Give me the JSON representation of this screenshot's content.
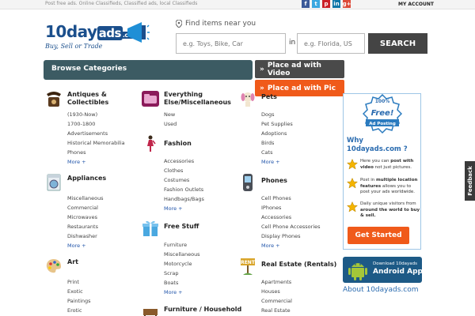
{
  "topbar": {
    "tagline": "Post free ads. Online Classifieds, Classified ads, local Classifieds",
    "socials": [
      {
        "icon": "facebook-icon",
        "glyph": "f",
        "color": "#3b5998"
      },
      {
        "icon": "twitter-icon",
        "glyph": "t",
        "color": "#3aa8e0"
      },
      {
        "icon": "pinterest-icon",
        "glyph": "p",
        "color": "#cb2027"
      },
      {
        "icon": "linkedin-icon",
        "glyph": "in",
        "color": "#0e76a8"
      },
      {
        "icon": "google-plus-icon",
        "glyph": "g+",
        "color": "#dd4b39"
      }
    ],
    "my_account": "MY ACCOUNT"
  },
  "header": {
    "logo_main": "10day",
    "logo_ads": "ads",
    "logo_com": ".com",
    "logo_sub": "Buy, Sell or Trade",
    "find_label": "Find items near you",
    "search_placeholder": "e.g. Toys, Bike, Car",
    "in_label": "in",
    "location_placeholder": "e.g. Florida, US",
    "search_button": "SEARCH"
  },
  "nav": {
    "browse_label": "Browse Categories",
    "place_video": "Place ad with Video",
    "place_pic": "Place ad with Pic"
  },
  "categories": {
    "antiques": {
      "title": "Antiques & Collectibles",
      "items": [
        "(1930-Now)",
        "1700-1800",
        "Advertisements",
        "Historical Memorabilia",
        "Phones",
        "More +"
      ]
    },
    "appliances": {
      "title": "Appliances",
      "items": [
        "Miscellaneous",
        "Commercial",
        "Microwaves",
        "Restaurants",
        "Dishwasher",
        "More +"
      ]
    },
    "art": {
      "title": "Art",
      "items": [
        "Print",
        "Exotic",
        "Paintings",
        "Erotic"
      ]
    },
    "everything": {
      "title": "Everything Else/Miscellaneous",
      "items": [
        "New",
        "Used"
      ]
    },
    "fashion": {
      "title": "Fashion",
      "items": [
        "Accessories",
        "Clothes",
        "Costumes",
        "Fashion Outlets",
        "Handbags/Bags",
        "More +"
      ]
    },
    "freestuff": {
      "title": "Free Stuff",
      "items": [
        "Furniture",
        "Miscellaneous",
        "Motorcycle",
        "Scrap",
        "Boats",
        "More +"
      ]
    },
    "furniture": {
      "title": "Furniture / Household",
      "items": []
    },
    "pets": {
      "title": "Pets",
      "items": [
        "Dogs",
        "Pet Supplies",
        "Adoptions",
        "Birds",
        "Cats",
        "More +"
      ]
    },
    "phones": {
      "title": "Phones",
      "items": [
        "Cell Phones",
        "IPhones",
        "Accessories",
        "Cell Phone Accessories",
        "Display Phones",
        "More +"
      ]
    },
    "realestate": {
      "title": "Real Estate (Rentals)",
      "items": [
        "Apartments",
        "Houses",
        "Commercial",
        "Real Estate"
      ]
    }
  },
  "sidebar": {
    "badge_percent": "100%",
    "badge_free": "Free!",
    "badge_posting": "Ad Posting",
    "why_title": "Why 10dayads.com ?",
    "why_items": [
      {
        "pre": "Here you can ",
        "bold": "post with video",
        "post": " not just pictures."
      },
      {
        "pre": "Post in ",
        "bold": "multiple location features",
        "post": " allows you to post your ads worldwide."
      },
      {
        "pre": "Daily unique visitors from ",
        "bold": "around the world to buy & sell.",
        "post": ""
      }
    ],
    "get_started": "Get Started",
    "android_small": "Download 10dayads",
    "android_big": "Android App",
    "about_link": "About 10dayads.com"
  },
  "feedback": "Feedback"
}
